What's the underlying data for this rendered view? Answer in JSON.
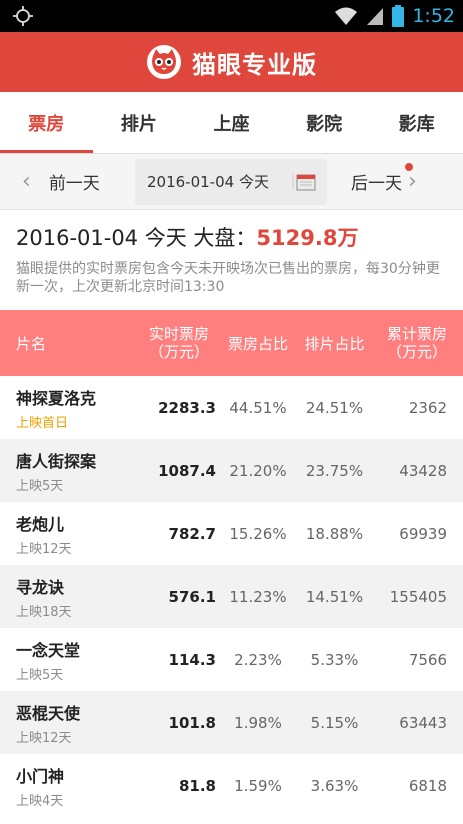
{
  "status": {
    "time": "1:52"
  },
  "app": {
    "title": "猫眼专业版"
  },
  "tabs": [
    {
      "label": "票房",
      "active": true
    },
    {
      "label": "排片",
      "active": false
    },
    {
      "label": "上座",
      "active": false
    },
    {
      "label": "影院",
      "active": false
    },
    {
      "label": "影库",
      "active": false
    }
  ],
  "datebar": {
    "prev": "前一天",
    "date": "2016-01-04 今天",
    "next": "后一天"
  },
  "summary": {
    "headline": "2016-01-04 今天 大盘：",
    "total": "5129.8万",
    "note": "猫眼提供的实时票房包含今天未开映场次已售出的票房，每30分钟更新一次，上次更新北京时间13:30"
  },
  "table": {
    "headers": {
      "name": "片名",
      "realtime": "实时票房",
      "realtime_unit": "（万元）",
      "share": "票房占比",
      "sched": "排片占比",
      "total": "累计票房",
      "total_unit": "（万元）"
    },
    "rows": [
      {
        "name": "神探夏洛克",
        "days": "上映首日",
        "rt": "2283.3",
        "share": "44.51%",
        "sched": "24.51%",
        "total": "2362"
      },
      {
        "name": "唐人街探案",
        "days": "上映5天",
        "rt": "1087.4",
        "share": "21.20%",
        "sched": "23.75%",
        "total": "43428"
      },
      {
        "name": "老炮儿",
        "days": "上映12天",
        "rt": "782.7",
        "share": "15.26%",
        "sched": "18.88%",
        "total": "69939"
      },
      {
        "name": "寻龙诀",
        "days": "上映18天",
        "rt": "576.1",
        "share": "11.23%",
        "sched": "14.51%",
        "total": "155405"
      },
      {
        "name": "一念天堂",
        "days": "上映5天",
        "rt": "114.3",
        "share": "2.23%",
        "sched": "5.33%",
        "total": "7566"
      },
      {
        "name": "恶棍天使",
        "days": "上映12天",
        "rt": "101.8",
        "share": "1.98%",
        "sched": "5.15%",
        "total": "63443"
      },
      {
        "name": "小门神",
        "days": "上映4天",
        "rt": "81.8",
        "share": "1.59%",
        "sched": "3.63%",
        "total": "6818"
      }
    ]
  },
  "colors": {
    "brand": "#e0473c",
    "header_row": "#ff7f7f",
    "first_day": "#f0a000",
    "status_time": "#33b5e5"
  }
}
